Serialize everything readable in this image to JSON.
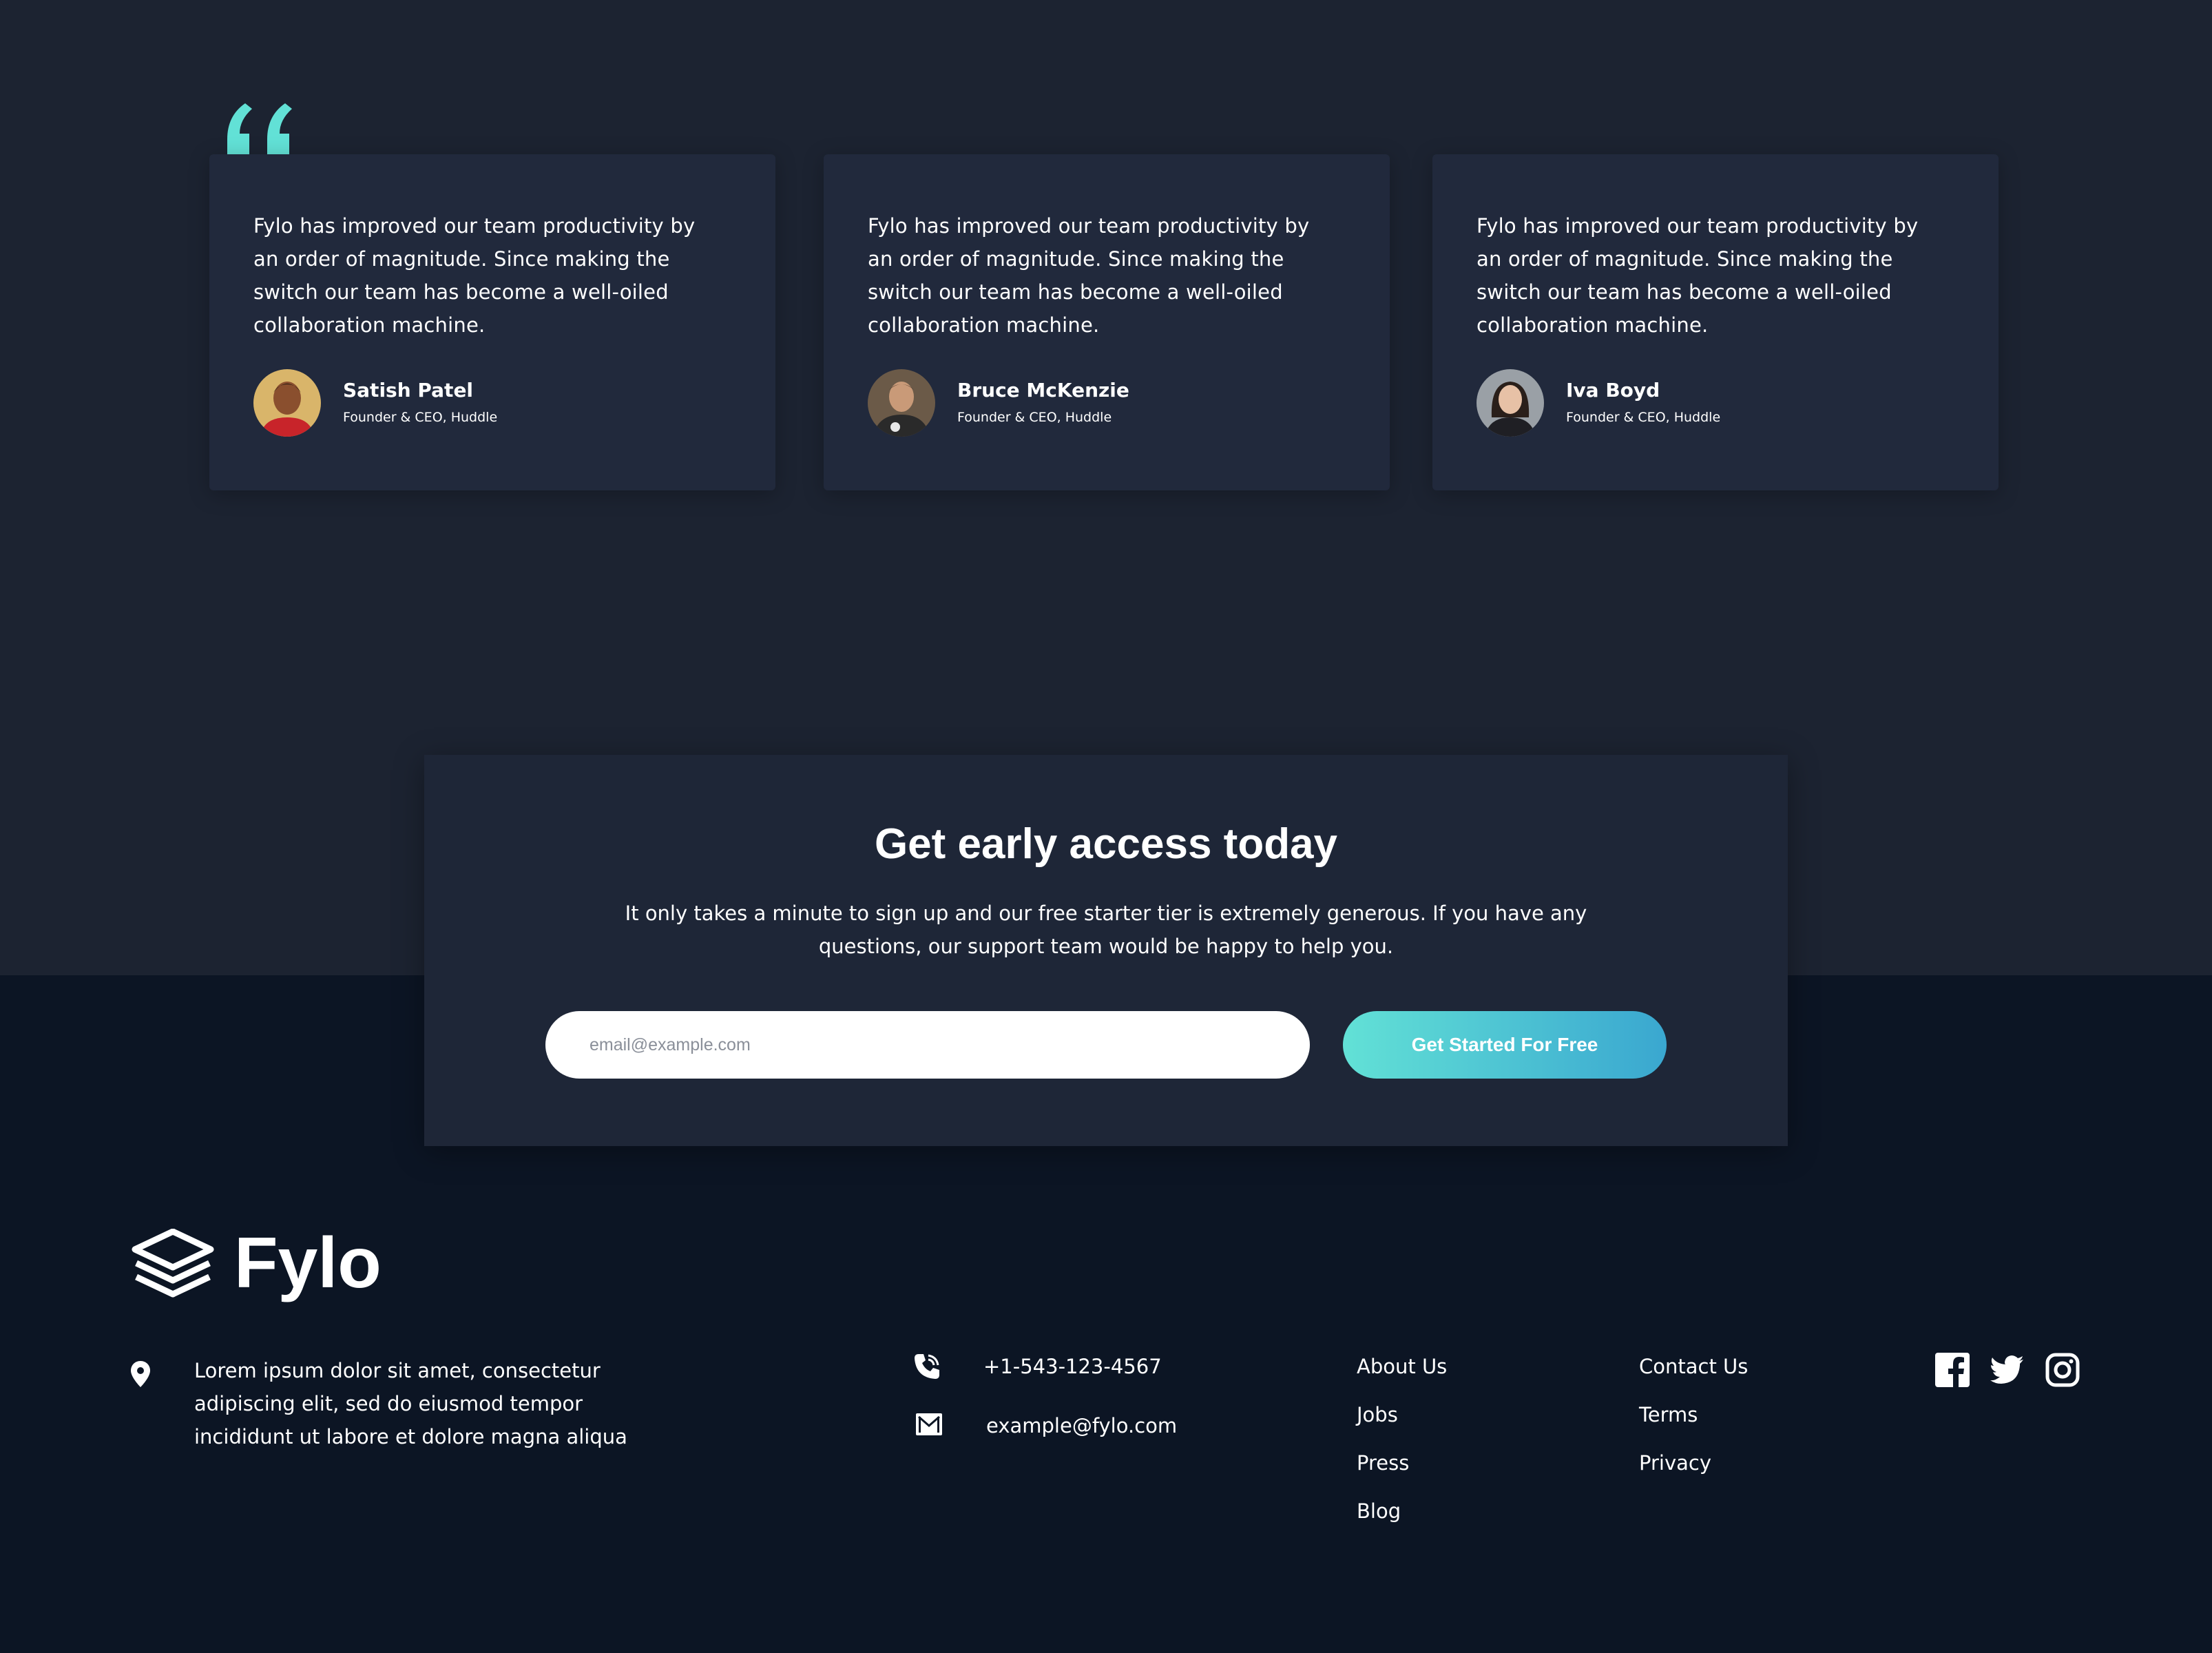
{
  "testimonials": [
    {
      "text": "Fylo has improved our team productivity by an order of magnitude. Since making the switch our team has become a well-oiled collaboration machine.",
      "name": "Satish Patel",
      "role": "Founder & CEO, Huddle"
    },
    {
      "text": "Fylo has improved our team productivity by an order of magnitude. Since making the switch our team has become a well-oiled collaboration machine.",
      "name": "Bruce McKenzie",
      "role": "Founder & CEO, Huddle"
    },
    {
      "text": "Fylo has improved our team productivity by an order of magnitude. Since making the switch our team has become a well-oiled collaboration machine.",
      "name": "Iva Boyd",
      "role": "Founder & CEO, Huddle"
    }
  ],
  "cta": {
    "title": "Get early access today",
    "text": "It only takes a minute to sign up and our free starter tier is extremely generous. If you have any questions, our support team would be happy to help you.",
    "email_placeholder": "email@example.com",
    "button_label": "Get Started For Free"
  },
  "footer": {
    "logo_text": "Fylo",
    "address": "Lorem ipsum dolor sit amet, consectetur adipiscing elit, sed do eiusmod tempor incididunt ut labore et dolore magna aliqua",
    "phone": "+1-543-123-4567",
    "email": "example@fylo.com",
    "links_col1": [
      "About Us",
      "Jobs",
      "Press",
      "Blog"
    ],
    "links_col2": [
      "Contact Us",
      "Terms",
      "Privacy"
    ],
    "social_icons": [
      "facebook-icon",
      "twitter-icon",
      "instagram-icon"
    ]
  },
  "colors": {
    "accent": "#62e1d6",
    "button_gradient_end": "#3aa7d0",
    "card_bg": "#21293c",
    "footer_bg": "#0c1524"
  }
}
